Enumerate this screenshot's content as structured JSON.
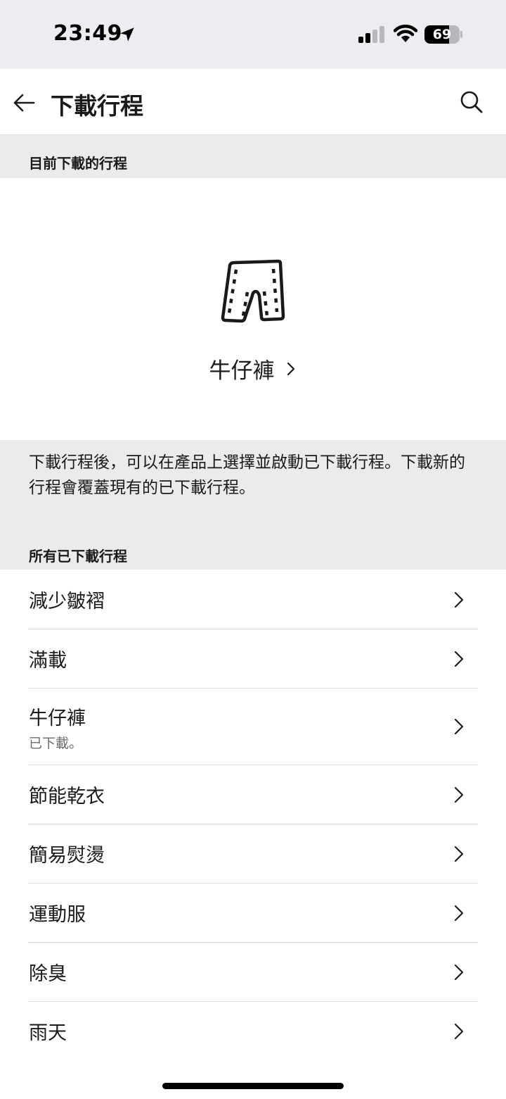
{
  "status_bar": {
    "time": "23:49",
    "battery_level": "69",
    "battery_fraction": 0.69
  },
  "header": {
    "title": "下載行程",
    "back_icon": "arrow-left-icon",
    "search_icon": "search-icon"
  },
  "current_section": {
    "heading": "目前下載的行程",
    "program_name": "牛仔褲",
    "program_icon": "jeans-icon"
  },
  "info": {
    "text": "下載行程後，可以在產品上選擇並啟動已下載行程。下載新的行程會覆蓋現有的已下載行程。"
  },
  "all_section": {
    "heading": "所有已下載行程",
    "items": [
      {
        "label": "減少皺褶",
        "sub": ""
      },
      {
        "label": "滿載",
        "sub": ""
      },
      {
        "label": "牛仔褲",
        "sub": "已下載。"
      },
      {
        "label": "節能乾衣",
        "sub": ""
      },
      {
        "label": "簡易熨燙",
        "sub": ""
      },
      {
        "label": "運動服",
        "sub": ""
      },
      {
        "label": "除臭",
        "sub": ""
      },
      {
        "label": "雨天",
        "sub": ""
      }
    ]
  },
  "colors": {
    "status_bg": "#ecedf1",
    "section_bg": "#ebebeb",
    "text": "#1a1a1a",
    "subtext": "#6b6b6b"
  }
}
